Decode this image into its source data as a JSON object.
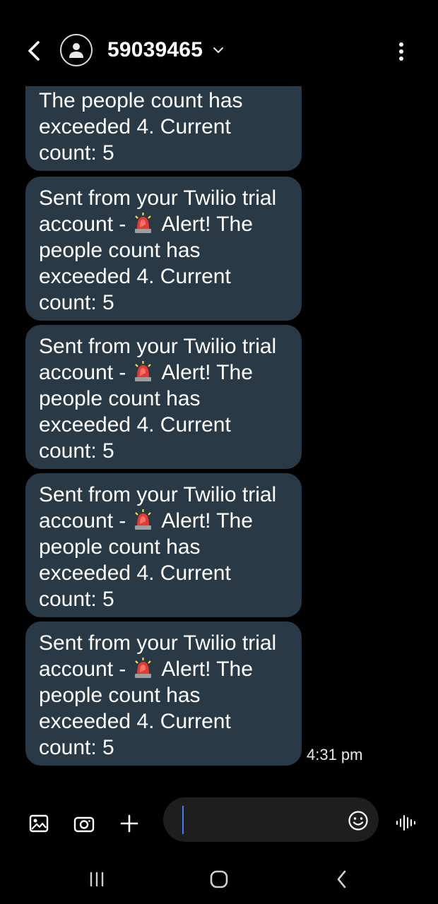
{
  "header": {
    "contact_name": "59039465",
    "icons": {
      "back": "back-arrow-icon",
      "avatar": "person-avatar-icon",
      "chevron": "chevron-down-icon",
      "more": "more-vertical-icon"
    }
  },
  "messages": {
    "partial_text": "The people count has exceeded 4. Current count: 5",
    "items": [
      {
        "prefix": "Sent from your Twilio trial account - ",
        "emoji": "🚨",
        "suffix": " Alert! The people count has exceeded 4. Current count: 5"
      },
      {
        "prefix": "Sent from your Twilio trial account - ",
        "emoji": "🚨",
        "suffix": " Alert! The people count has exceeded 4. Current count: 5"
      },
      {
        "prefix": "Sent from your Twilio trial account - ",
        "emoji": "🚨",
        "suffix": " Alert! The people count has exceeded 4. Current count: 5"
      },
      {
        "prefix": "Sent from your Twilio trial account - ",
        "emoji": "🚨",
        "suffix": " Alert! The people count has exceeded 4. Current count: 5"
      }
    ],
    "timestamp": "4:31 pm"
  },
  "composer": {
    "input_value": "",
    "icons": [
      "gallery-icon",
      "camera-icon",
      "plus-icon",
      "emoji-icon",
      "voice-icon"
    ]
  },
  "navbar": {
    "icons": [
      "recent-apps-icon",
      "home-icon",
      "back-icon"
    ]
  },
  "colors": {
    "background": "#000000",
    "bubble": "#2a3946",
    "input": "#1e1e1e",
    "caret": "#3d7ef5"
  }
}
